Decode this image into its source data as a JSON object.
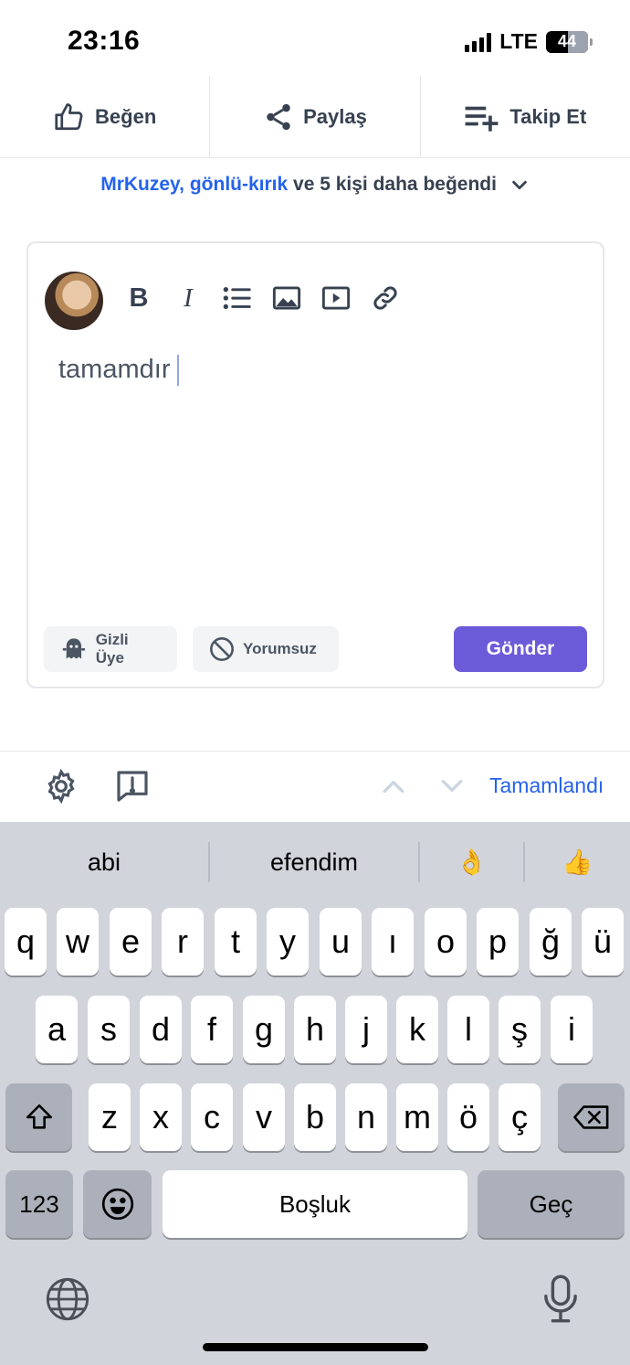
{
  "status_bar": {
    "time": "23:16",
    "network": "LTE",
    "battery": "44"
  },
  "actions": [
    {
      "label": "Beğen",
      "icon": "thumbs-up-icon"
    },
    {
      "label": "Paylaş",
      "icon": "share-icon"
    },
    {
      "label": "Takip Et",
      "icon": "playlist-add-icon"
    }
  ],
  "likes": {
    "user1": "MrKuzey",
    "sep": ", ",
    "user2": "gönlü-kırık",
    "rest_prefix": " ve ",
    "count_text": "5 kişi daha",
    "rest_suffix": " beğendi"
  },
  "editor": {
    "text": "tamamdır",
    "toolbar": [
      "bold",
      "italic",
      "list",
      "image",
      "video",
      "link"
    ],
    "bold_glyph": "B",
    "italic_glyph": "I",
    "anon_label": "Gizli Üye",
    "no_comment_label": "Yorumsuz",
    "send_label": "Gönder",
    "send_color": "#6c5bd9"
  },
  "accessory": {
    "done_label": "Tamamlandı"
  },
  "keyboard": {
    "suggestions": [
      "abi",
      "efendim",
      "👌",
      "👍"
    ],
    "row1": [
      "q",
      "w",
      "e",
      "r",
      "t",
      "y",
      "u",
      "ı",
      "o",
      "p",
      "ğ",
      "ü"
    ],
    "row2": [
      "a",
      "s",
      "d",
      "f",
      "g",
      "h",
      "j",
      "k",
      "l",
      "ş",
      "i"
    ],
    "row3": [
      "z",
      "x",
      "c",
      "v",
      "b",
      "n",
      "m",
      "ö",
      "ç"
    ],
    "numbers_label": "123",
    "space_label": "Boşluk",
    "return_label": "Geç"
  }
}
